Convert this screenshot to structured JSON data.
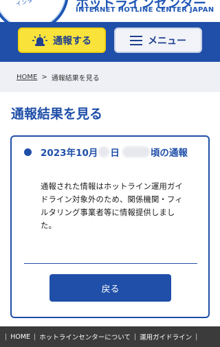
{
  "header": {
    "logo_ring_text": "インターネット・ホットラインセンター",
    "title_ja": "ホットラインセンター",
    "title_en": "INTERNET HOTLINE CENTER JAPAN"
  },
  "nav": {
    "report_label": "通報する",
    "menu_label": "メニュー"
  },
  "breadcrumb": {
    "home": "HOME",
    "separator": ">",
    "current": "通報結果を見る"
  },
  "page": {
    "title": "通報結果を見る"
  },
  "result": {
    "header_year_month": "2023年10月",
    "header_day_suffix": "日",
    "header_suffix": "頃の通報",
    "message": "通報された情報はホットライン運用ガイドライン対象外のため、関係機関・フィルタリング事業者等に情報提供しました。",
    "back_label": "戻る"
  },
  "footer": {
    "sep": "|",
    "links": [
      "HOME",
      "ホットラインセンターについて",
      "運用ガイドライン"
    ]
  },
  "colors": {
    "primary": "#1f4fa8",
    "report_yellow": "#f9e33a",
    "footer_bg": "#3b3b3b"
  }
}
